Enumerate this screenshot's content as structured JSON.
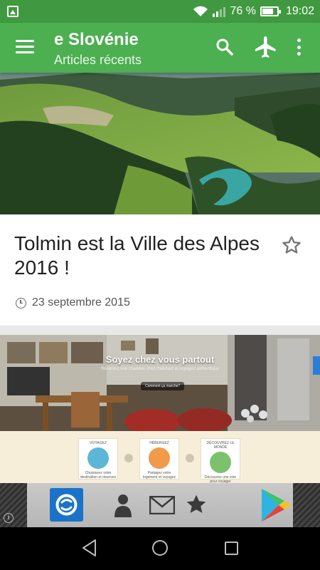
{
  "status_bar": {
    "battery_percent": "76 %",
    "battery_level": 0.76,
    "time": "19:02",
    "icons": [
      "gallery-icon",
      "wifi-icon",
      "signal-icon",
      "battery-icon"
    ]
  },
  "app_bar": {
    "title": "e Slovénie",
    "subtitle": "Articles récents",
    "color": "#4caf50",
    "actions": [
      "menu-icon",
      "search-icon",
      "airplane-icon",
      "more-vert-icon"
    ]
  },
  "articles": [
    {
      "title": "Tolmin est la Ville des Alpes 2016 !",
      "date": "23 septembre 2015",
      "image": "aerial view of alpine valley with turquoise river"
    },
    {
      "image": "website screenshot with living room photo",
      "screenshot": {
        "heading": "Soyez chez vous partout",
        "subheading": "Réservez une chambre chez l'habitant et voyagez authentique",
        "button": "Comment ça marche?",
        "steps": [
          {
            "label": "VOYAGEZ",
            "caption": "Choisissez votre destination et réservez"
          },
          {
            "label": "HÉBERGEZ",
            "caption": "Partagez votre logement et voyagez"
          },
          {
            "label": "DÉCOUVREZ LE MONDE",
            "caption": "Découvrez une voie pour voyager"
          }
        ]
      }
    }
  ],
  "ad_banner": {
    "icons": [
      "app-logo-icon",
      "person-icon",
      "mail-icon",
      "star-icon",
      "play-store-icon",
      "info-icon"
    ],
    "info_glyph": "i"
  },
  "nav_bar": {
    "icons": [
      "back-icon",
      "home-icon",
      "recents-icon"
    ]
  }
}
